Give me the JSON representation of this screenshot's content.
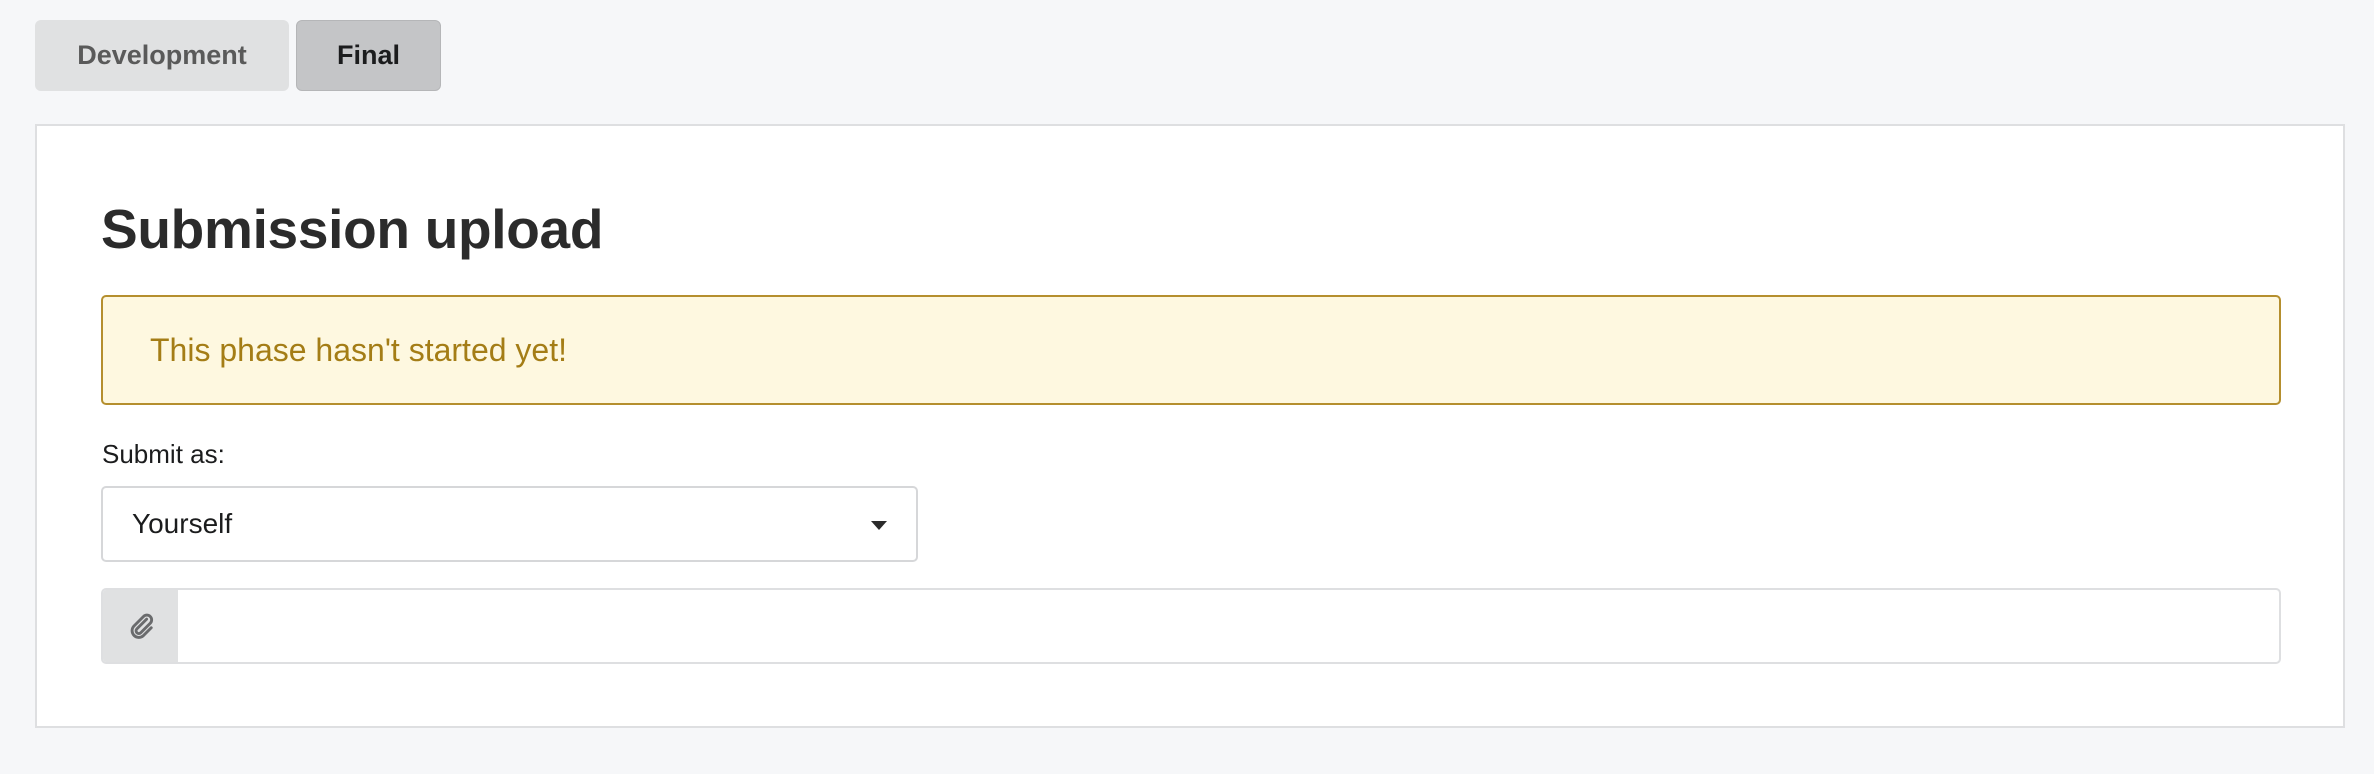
{
  "tabs": [
    {
      "label": "Development",
      "active": false
    },
    {
      "label": "Final",
      "active": true
    }
  ],
  "panel": {
    "title": "Submission upload",
    "warning_text": "This phase hasn't started yet!",
    "submit_as_label": "Submit as:",
    "submit_as_value": "Yourself",
    "attach_icon": "paperclip-icon",
    "file_input_value": ""
  },
  "colors": {
    "warning_bg": "#fef8e0",
    "warning_border": "#b58f2e",
    "warning_text": "#a47d16",
    "tab_active_bg": "#c4c5c7",
    "tab_inactive_bg": "#e0e1e2"
  }
}
